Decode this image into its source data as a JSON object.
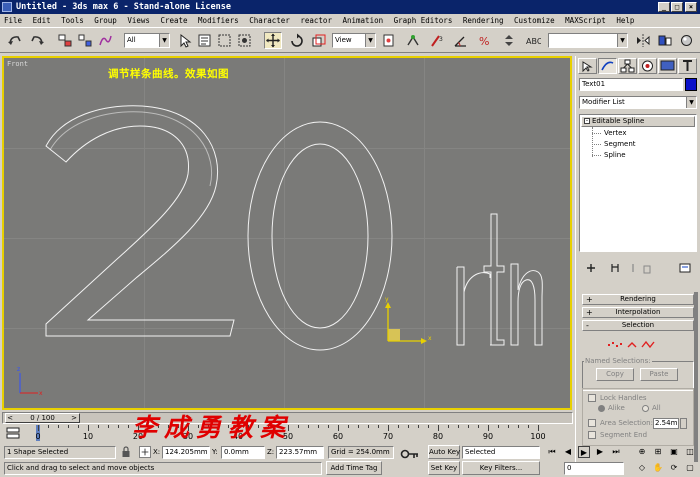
{
  "window": {
    "title": "Untitled - 3ds max 6 - Stand-alone License"
  },
  "menu": {
    "items": [
      "File",
      "Edit",
      "Tools",
      "Group",
      "Views",
      "Create",
      "Modifiers",
      "Character",
      "reactor",
      "Animation",
      "Graph Editors",
      "Rendering",
      "Customize",
      "MAXScript",
      "Help"
    ]
  },
  "toolbar": {
    "selection_filter": "All",
    "reference_coord": "View",
    "named_selection": ""
  },
  "viewport": {
    "label": "Front",
    "caption": "调节样条曲线。效果如图",
    "text_shape": "20th",
    "border_color": "#e8d000",
    "background": "#7a7a78"
  },
  "command_panel": {
    "object_name": "Text01",
    "object_color": "#0a10c8",
    "modifier_list": "Modifier List",
    "stack": {
      "top": "Editable Spline",
      "sub_objects": [
        "Vertex",
        "Segment",
        "Spline"
      ]
    },
    "rollouts": {
      "rendering": "Rendering",
      "interpolation": "Interpolation",
      "selection": "Selection"
    },
    "named_selections": {
      "label": "Named Selections:",
      "copy": "Copy",
      "paste": "Paste"
    },
    "lock_handles": "Lock Handles",
    "alike": "Alike",
    "all": "All",
    "area_selection": "Area Selection:",
    "area_value": "2.54m",
    "segment_end": "Segment End"
  },
  "timeline": {
    "slider_label": "0 / 100",
    "ticks": [
      "0",
      "10",
      "20",
      "30",
      "40",
      "50",
      "60",
      "70",
      "80",
      "90",
      "100"
    ],
    "watermark": "李成勇教案"
  },
  "status": {
    "selection": "1 Shape Selected",
    "prompt": "Click and drag to select and move objects",
    "x_label": "X:",
    "x_value": "124.205mm",
    "y_label": "Y:",
    "y_value": "0.0mm",
    "z_label": "Z:",
    "z_value": "223.57mm",
    "grid": "Grid = 254.0mm",
    "add_time_tag": "Add Time Tag",
    "auto_key": "Auto Key",
    "set_key": "Set Key",
    "key_mode": "Selected",
    "key_filters": "Key Filters...",
    "current_frame": "0"
  }
}
